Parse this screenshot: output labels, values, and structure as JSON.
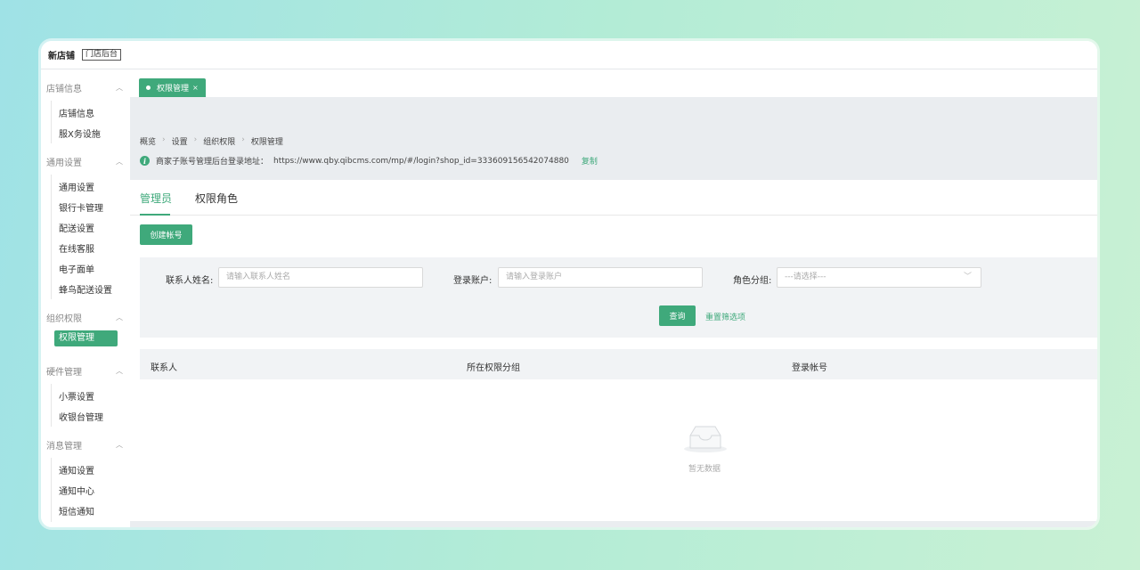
{
  "topbar": {
    "store_name": "新店铺",
    "store_badge": "门店后台"
  },
  "sidebar": {
    "groups": [
      {
        "title": "店铺信息",
        "items": [
          "店铺信息",
          "服X务设施"
        ]
      },
      {
        "title": "通用设置",
        "items": [
          "通用设置",
          "银行卡管理",
          "配送设置",
          "在线客服",
          "电子面单",
          "蜂鸟配送设置"
        ]
      },
      {
        "title": "组织权限",
        "items": [
          "权限管理"
        ]
      },
      {
        "title": "硬件管理",
        "items": [
          "小票设置",
          "收银台管理"
        ]
      },
      {
        "title": "消息管理",
        "items": [
          "通知设置",
          "通知中心",
          "短信通知"
        ]
      }
    ],
    "active_item": "权限管理"
  },
  "tabs": [
    {
      "label": "权限管理",
      "close": "×"
    }
  ],
  "breadcrumb": [
    "概览",
    "设置",
    "组织权限",
    "权限管理"
  ],
  "breadcrumb_sep": "›",
  "notice": {
    "icon": "info-icon",
    "label": "商家子账号管理后台登录地址：",
    "url": "https://www.qby.qibcms.com/mp/#/login?shop_id=333609156542074880",
    "copy": "复制"
  },
  "subtabs": [
    "管理员",
    "权限角色"
  ],
  "active_subtab": "管理员",
  "create_button": "创建帐号",
  "filters": {
    "contact_label": "联系人姓名:",
    "contact_placeholder": "请输入联系人姓名",
    "account_label": "登录账户:",
    "account_placeholder": "请输入登录账户",
    "role_label": "角色分组:",
    "role_placeholder": "---请选择---",
    "query": "查询",
    "reset": "重置筛选项"
  },
  "table": {
    "columns": [
      "联系人",
      "所在权限分组",
      "登录帐号"
    ],
    "rows": [],
    "empty_text": "暂无数据"
  },
  "colors": {
    "accent": "#3fa97b"
  }
}
